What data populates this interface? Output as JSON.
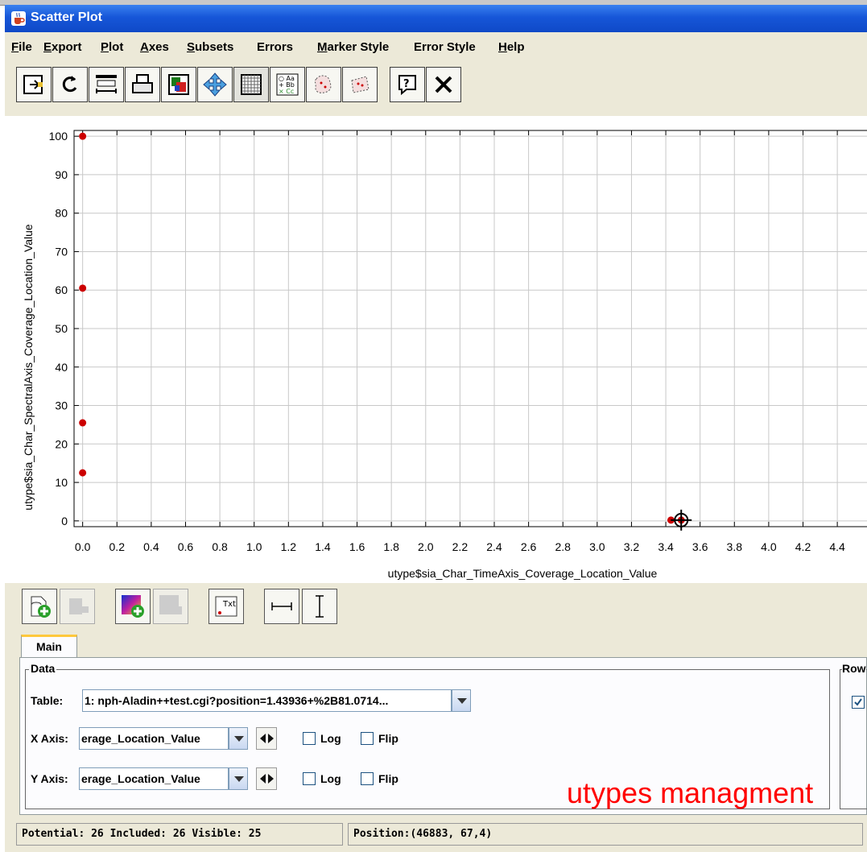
{
  "window": {
    "title": "Scatter Plot"
  },
  "menubar": {
    "items": [
      {
        "label": "File",
        "mnemonic": "F",
        "rest": "ile"
      },
      {
        "label": "Export",
        "mnemonic": "E",
        "rest": "xport"
      },
      {
        "label": "Plot",
        "mnemonic": "P",
        "rest": "lot"
      },
      {
        "label": "Axes",
        "mnemonic": "A",
        "rest": "xes"
      },
      {
        "label": "Subsets",
        "mnemonic": "S",
        "rest": "ubsets"
      },
      {
        "label": "Errors",
        "mnemonic": "",
        "rest": "Errors"
      },
      {
        "label": "Marker Style",
        "mnemonic": "M",
        "rest": "arker Style"
      },
      {
        "label": "Error Style",
        "mnemonic": "",
        "rest": "Error Style"
      },
      {
        "label": "Help",
        "mnemonic": "H",
        "rest": "elp"
      }
    ]
  },
  "toolbar": {
    "icons": [
      "export-icon",
      "replot-icon",
      "axis-editor-icon",
      "print-icon",
      "color-image-icon",
      "navigate-icon",
      "grid-icon",
      "legend-icon",
      "subset-blob-icon",
      "subset-region-icon",
      "help-icon",
      "close-icon"
    ]
  },
  "chart_data": {
    "type": "scatter",
    "xlabel": "utype$sia_Char_TimeAxis_Coverage_Location_Value",
    "ylabel": "utype$sia_Char_SpectralAxis_Coverage_Location_Value",
    "xticks": [
      "0.0",
      "0.2",
      "0.4",
      "0.6",
      "0.8",
      "1.0",
      "1.2",
      "1.4",
      "1.6",
      "1.8",
      "2.0",
      "2.2",
      "2.4",
      "2.6",
      "2.8",
      "3.0",
      "3.2",
      "3.4",
      "3.6",
      "3.8",
      "4.0",
      "4.2",
      "4.4"
    ],
    "yticks": [
      "0",
      "10",
      "20",
      "30",
      "40",
      "50",
      "60",
      "70",
      "80",
      "90",
      "100"
    ],
    "xlim": [
      -0.05,
      4.55
    ],
    "ylim": [
      -1.5,
      101.5
    ],
    "grid": true,
    "marker_color": "#cc0000",
    "series": [
      {
        "x": [
          0,
          0,
          0,
          0,
          3.43,
          3.49
        ],
        "y": [
          100,
          60.5,
          25.5,
          12.5,
          0.2,
          0.2
        ]
      }
    ],
    "highlighted_point": {
      "x": 3.49,
      "y": 0.2
    }
  },
  "toolbar2": {
    "icons": [
      "add-dataset-icon",
      "remove-dataset-icon",
      "add-density-layer-icon",
      "remove-layer-icon",
      "add-text-label-icon",
      "x-error-bar-icon",
      "y-error-bar-icon"
    ]
  },
  "tabs": [
    {
      "label": "Main"
    }
  ],
  "data_panel": {
    "legend": "Data",
    "table_label": "Table:",
    "table_value": "1: nph-Aladin++test.cgi?position=1.43936+%2B81.0714...",
    "x_axis_label": "X Axis:",
    "x_axis_value": "erage_Location_Value",
    "y_axis_label": "Y Axis:",
    "y_axis_value": "erage_Location_Value",
    "log_label": "Log",
    "flip_label": "Flip"
  },
  "row_panel": {
    "legend": "Row"
  },
  "overlay_text": "utypes managment",
  "status": {
    "counts": "Potential: 26 Included: 26 Visible: 25",
    "position": "Position:(46883, 67,4)"
  }
}
